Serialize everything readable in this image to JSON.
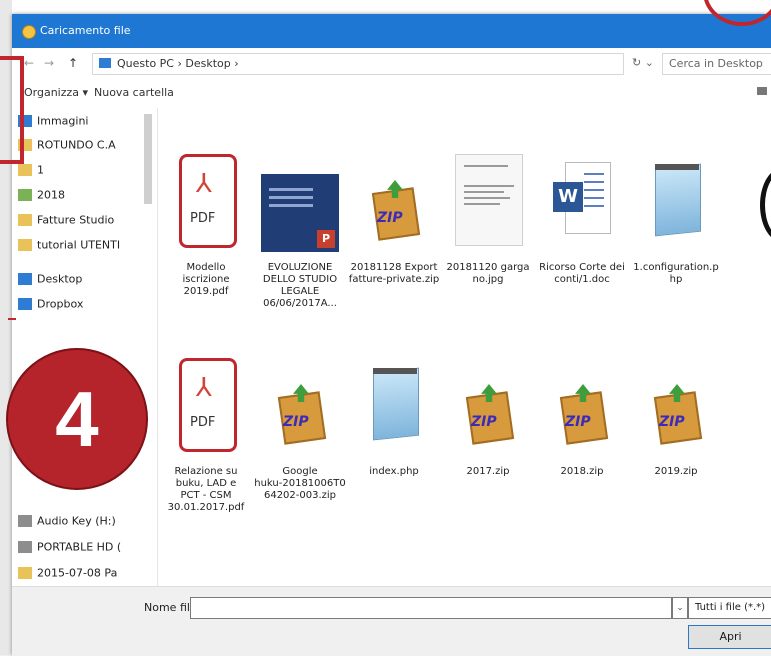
{
  "window": {
    "title": "Caricamento file"
  },
  "address": {
    "back": "←",
    "forward": "→",
    "up": "↑",
    "path": "Questo PC › Desktop ›",
    "search_placeholder": "Cerca in Desktop",
    "refresh": "↻ ⌄"
  },
  "toolbar": {
    "organize": "Organizza ▾",
    "new_folder": "Nuova cartella"
  },
  "sidebar": {
    "items": [
      {
        "label": "Immagini",
        "icon": "pictures-icon"
      },
      {
        "label": "ROTUNDO C.A",
        "icon": "folder-icon"
      },
      {
        "label": "1",
        "icon": "folder-icon"
      },
      {
        "label": "2018",
        "icon": "image-folder-icon"
      },
      {
        "label": "Fatture Studio",
        "icon": "folder-icon"
      },
      {
        "label": "tutorial UTENTI",
        "icon": "folder-icon"
      },
      {
        "label": "Desktop",
        "icon": "desktop-icon"
      },
      {
        "label": "Dropbox",
        "icon": "dropbox-icon"
      },
      {
        "label": "Audio Key (H:)",
        "icon": "drive-icon"
      },
      {
        "label": "PORTABLE HD (",
        "icon": "drive-icon"
      },
      {
        "label": "2015-07-08 Pa",
        "icon": "folder-icon"
      }
    ]
  },
  "files": [
    {
      "name": "Modello\niscrizione\n2019.pdf",
      "type": "pdf"
    },
    {
      "name": "EVOLUZIONE\nDELLO STUDIO\nLEGALE\n06/06/2017A...",
      "type": "ppt"
    },
    {
      "name": "20181128 Export\nfatture-private.zip",
      "type": "zip"
    },
    {
      "name": "20181120 garga\nno.jpg",
      "type": "jpg"
    },
    {
      "name": "Ricorso Corte dei\nconti/1.doc",
      "type": "doc"
    },
    {
      "name": "1.configuration.p\nhp",
      "type": "php"
    },
    {
      "name": "Relazione su\nbuku, LAD e\nPCT - CSM\n30.01.2017.pdf",
      "type": "pdf"
    },
    {
      "name": "Google\nhuku-20181006T0\n64202-003.zip",
      "type": "zip"
    },
    {
      "name": "index.php",
      "type": "php"
    },
    {
      "name": "2017.zip",
      "type": "zip"
    },
    {
      "name": "2018.zip",
      "type": "zip"
    },
    {
      "name": "2019.zip",
      "type": "zip"
    }
  ],
  "icons": {
    "pdf_glyph": "⅄",
    "pdf_text": "PDF",
    "ppt_badge": "P",
    "zip_text": "ZIP",
    "word_text": "W"
  },
  "footer": {
    "filename_label": "Nome file:",
    "filename_value": "",
    "dropdown_arrow": "⌄",
    "filter": "Tutti i file (*.*)",
    "open": "Apri"
  },
  "annotation": {
    "step": "4"
  },
  "colors": {
    "titlebar": "#1e77d3",
    "annotation_red": "#b5232b"
  }
}
